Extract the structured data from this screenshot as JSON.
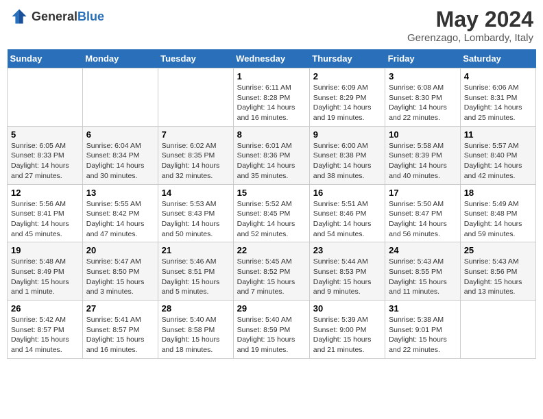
{
  "header": {
    "logo_general": "General",
    "logo_blue": "Blue",
    "month": "May 2024",
    "location": "Gerenzago, Lombardy, Italy"
  },
  "days_of_week": [
    "Sunday",
    "Monday",
    "Tuesday",
    "Wednesday",
    "Thursday",
    "Friday",
    "Saturday"
  ],
  "weeks": [
    [
      {
        "day": "",
        "info": ""
      },
      {
        "day": "",
        "info": ""
      },
      {
        "day": "",
        "info": ""
      },
      {
        "day": "1",
        "info": "Sunrise: 6:11 AM\nSunset: 8:28 PM\nDaylight: 14 hours\nand 16 minutes."
      },
      {
        "day": "2",
        "info": "Sunrise: 6:09 AM\nSunset: 8:29 PM\nDaylight: 14 hours\nand 19 minutes."
      },
      {
        "day": "3",
        "info": "Sunrise: 6:08 AM\nSunset: 8:30 PM\nDaylight: 14 hours\nand 22 minutes."
      },
      {
        "day": "4",
        "info": "Sunrise: 6:06 AM\nSunset: 8:31 PM\nDaylight: 14 hours\nand 25 minutes."
      }
    ],
    [
      {
        "day": "5",
        "info": "Sunrise: 6:05 AM\nSunset: 8:33 PM\nDaylight: 14 hours\nand 27 minutes."
      },
      {
        "day": "6",
        "info": "Sunrise: 6:04 AM\nSunset: 8:34 PM\nDaylight: 14 hours\nand 30 minutes."
      },
      {
        "day": "7",
        "info": "Sunrise: 6:02 AM\nSunset: 8:35 PM\nDaylight: 14 hours\nand 32 minutes."
      },
      {
        "day": "8",
        "info": "Sunrise: 6:01 AM\nSunset: 8:36 PM\nDaylight: 14 hours\nand 35 minutes."
      },
      {
        "day": "9",
        "info": "Sunrise: 6:00 AM\nSunset: 8:38 PM\nDaylight: 14 hours\nand 38 minutes."
      },
      {
        "day": "10",
        "info": "Sunrise: 5:58 AM\nSunset: 8:39 PM\nDaylight: 14 hours\nand 40 minutes."
      },
      {
        "day": "11",
        "info": "Sunrise: 5:57 AM\nSunset: 8:40 PM\nDaylight: 14 hours\nand 42 minutes."
      }
    ],
    [
      {
        "day": "12",
        "info": "Sunrise: 5:56 AM\nSunset: 8:41 PM\nDaylight: 14 hours\nand 45 minutes."
      },
      {
        "day": "13",
        "info": "Sunrise: 5:55 AM\nSunset: 8:42 PM\nDaylight: 14 hours\nand 47 minutes."
      },
      {
        "day": "14",
        "info": "Sunrise: 5:53 AM\nSunset: 8:43 PM\nDaylight: 14 hours\nand 50 minutes."
      },
      {
        "day": "15",
        "info": "Sunrise: 5:52 AM\nSunset: 8:45 PM\nDaylight: 14 hours\nand 52 minutes."
      },
      {
        "day": "16",
        "info": "Sunrise: 5:51 AM\nSunset: 8:46 PM\nDaylight: 14 hours\nand 54 minutes."
      },
      {
        "day": "17",
        "info": "Sunrise: 5:50 AM\nSunset: 8:47 PM\nDaylight: 14 hours\nand 56 minutes."
      },
      {
        "day": "18",
        "info": "Sunrise: 5:49 AM\nSunset: 8:48 PM\nDaylight: 14 hours\nand 59 minutes."
      }
    ],
    [
      {
        "day": "19",
        "info": "Sunrise: 5:48 AM\nSunset: 8:49 PM\nDaylight: 15 hours\nand 1 minute."
      },
      {
        "day": "20",
        "info": "Sunrise: 5:47 AM\nSunset: 8:50 PM\nDaylight: 15 hours\nand 3 minutes."
      },
      {
        "day": "21",
        "info": "Sunrise: 5:46 AM\nSunset: 8:51 PM\nDaylight: 15 hours\nand 5 minutes."
      },
      {
        "day": "22",
        "info": "Sunrise: 5:45 AM\nSunset: 8:52 PM\nDaylight: 15 hours\nand 7 minutes."
      },
      {
        "day": "23",
        "info": "Sunrise: 5:44 AM\nSunset: 8:53 PM\nDaylight: 15 hours\nand 9 minutes."
      },
      {
        "day": "24",
        "info": "Sunrise: 5:43 AM\nSunset: 8:55 PM\nDaylight: 15 hours\nand 11 minutes."
      },
      {
        "day": "25",
        "info": "Sunrise: 5:43 AM\nSunset: 8:56 PM\nDaylight: 15 hours\nand 13 minutes."
      }
    ],
    [
      {
        "day": "26",
        "info": "Sunrise: 5:42 AM\nSunset: 8:57 PM\nDaylight: 15 hours\nand 14 minutes."
      },
      {
        "day": "27",
        "info": "Sunrise: 5:41 AM\nSunset: 8:57 PM\nDaylight: 15 hours\nand 16 minutes."
      },
      {
        "day": "28",
        "info": "Sunrise: 5:40 AM\nSunset: 8:58 PM\nDaylight: 15 hours\nand 18 minutes."
      },
      {
        "day": "29",
        "info": "Sunrise: 5:40 AM\nSunset: 8:59 PM\nDaylight: 15 hours\nand 19 minutes."
      },
      {
        "day": "30",
        "info": "Sunrise: 5:39 AM\nSunset: 9:00 PM\nDaylight: 15 hours\nand 21 minutes."
      },
      {
        "day": "31",
        "info": "Sunrise: 5:38 AM\nSunset: 9:01 PM\nDaylight: 15 hours\nand 22 minutes."
      },
      {
        "day": "",
        "info": ""
      }
    ]
  ]
}
